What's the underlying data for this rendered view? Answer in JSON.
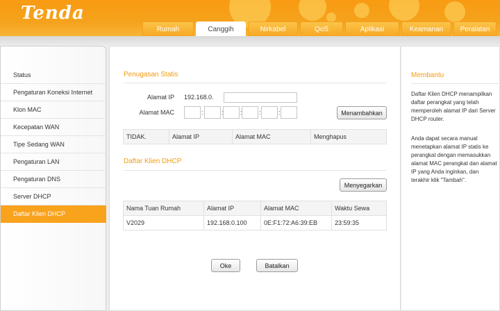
{
  "brand": {
    "logo": "Tenda"
  },
  "tabs": [
    "Rumah",
    "Canggih",
    "Nirkabel",
    "QoS",
    "Aplikasi",
    "Keamanan",
    "Peralatan"
  ],
  "active_tab": "Canggih",
  "sidebar": {
    "items": [
      "Status",
      "Pengaturan Koneksi Internet",
      "Klon MAC",
      "Kecepatan WAN",
      "Tipe Sedang WAN",
      "Pengaturan LAN",
      "Pengaturan DNS",
      "Server DHCP",
      "Daftar Klien DHCP"
    ],
    "active": "Daftar Klien DHCP"
  },
  "static": {
    "title": "Penugasan Statis",
    "ip_label": "Alamat IP",
    "ip_prefix": "192.168.0.",
    "ip_value": "",
    "mac_label": "Alamat MAC",
    "mac_separator": ":",
    "add_button": "Menambahkan",
    "table_headers": [
      "TIDAK.",
      "Alamat IP",
      "Alamat MAC",
      "Menghapus"
    ]
  },
  "clients": {
    "title": "Daftar Klien DHCP",
    "refresh_button": "Menyegarkan",
    "table_headers": [
      "Nama Tuan Rumah",
      "Alamat IP",
      "Alamat MAC",
      "Waktu Sewa"
    ],
    "rows": [
      [
        "V2029",
        "192.168.0.100",
        "0E:F1:72:A6:39:EB",
        "23:59:35"
      ]
    ]
  },
  "actions": {
    "ok": "Oke",
    "cancel": "Batalkan"
  },
  "help": {
    "title": "Membantu",
    "p1": "Daftar Klien DHCP menampilkan daftar perangkat yang telah memperoleh alamat IP dari Server DHCP router.",
    "p2": "Anda dapat secara manual menetapkan alamat IP statis ke perangkat dengan memasukkan alamat MAC perangkat dan alamat IP yang Anda inginkan, dan terakhir klik \"Tambah\"."
  },
  "colors": {
    "accent": "#f9a21c",
    "header": "#f89b12",
    "title": "#f29a0e"
  }
}
